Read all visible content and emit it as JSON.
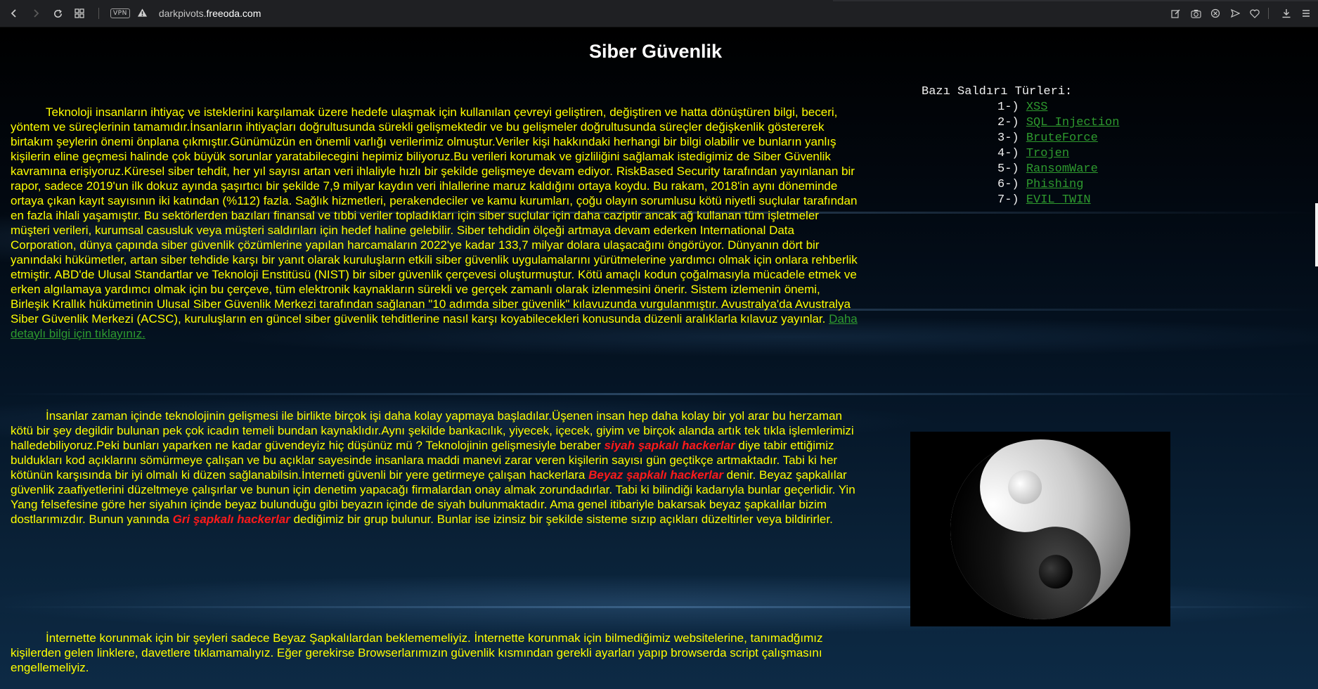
{
  "browser": {
    "url_prefix": "darkpivots.",
    "url_domain": "freeoda.com",
    "vpn_label": "VPN",
    "icons": {
      "back": "back-icon",
      "forward": "forward-icon",
      "reload": "reload-icon",
      "tabs": "tabs-grid-icon",
      "warning": "warning-icon",
      "edit": "edit-icon",
      "camera": "camera-icon",
      "block": "block-icon",
      "send": "send-icon",
      "heart": "heart-icon",
      "download": "download-icon",
      "menu": "menu-icon"
    }
  },
  "page": {
    "title": "Siber Güvenlik",
    "paragraph1": {
      "text": "Teknoloji insanların ihtiyaç ve isteklerini karşılamak üzere hedefe ulaşmak için kullanılan çevreyi geliştiren, değiştiren ve hatta dönüştüren bilgi, beceri, yöntem ve süreçlerinin tamamıdır.İnsanların ihtiyaçları doğrultusunda sürekli gelişmektedir ve bu gelişmeler doğrultusunda süreçler değişkenlik göstererek birtakım şeylerin önemi önplana çıkmıştır.Günümüzün en önemli varlığı verilerimiz olmuştur.Veriler kişi hakkındaki herhangi bir bilgi olabilir ve bunların yanlış kişilerin eline geçmesi halinde çok büyük sorunlar yaratabilecegini hepimiz biliyoruz.Bu verileri korumak ve gizliliğini sağlamak istedigimiz de Siber Güvenlik kavramına erişiyoruz.Küresel siber tehdit, her yıl sayısı artan veri ihlaliyle hızlı bir şekilde gelişmeye devam ediyor. RiskBased Security tarafından yayınlanan bir rapor, sadece 2019'un ilk dokuz ayında şaşırtıcı bir şekilde 7,9 milyar kaydın veri ihlallerine maruz kaldığını ortaya koydu. Bu rakam, 2018'in aynı döneminde ortaya çıkan kayıt sayısının iki katından (%112) fazla. Sağlık hizmetleri, perakendeciler ve kamu kurumları, çoğu olayın sorumlusu kötü niyetli suçlular tarafından en fazla ihlali yaşamıştır. Bu sektörlerden bazıları finansal ve tıbbi veriler topladıkları için siber suçlular için daha caziptir ancak ağ kullanan tüm işletmeler müşteri verileri, kurumsal casusluk veya müşteri saldırıları için hedef haline gelebilir. Siber tehdidin ölçeği artmaya devam ederken International Data Corporation, dünya çapında siber güvenlik çözümlerine yapılan harcamaların 2022'ye kadar 133,7 milyar dolara ulaşacağını öngörüyor. Dünyanın dört bir yanındaki hükümetler, artan siber tehdide karşı bir yanıt olarak kuruluşların etkili siber güvenlik uygulamalarını yürütmelerine yardımcı olmak için onlara rehberlik etmiştir. ABD'de Ulusal Standartlar ve Teknoloji Enstitüsü (NIST) bir siber güvenlik çerçevesi oluşturmuştur. Kötü amaçlı kodun çoğalmasıyla mücadele etmek ve erken algılamaya yardımcı olmak için bu çerçeve, tüm elektronik kaynakların sürekli ve gerçek zamanlı olarak izlenmesini önerir. Sistem izlemenin önemi, Birleşik Krallık hükümetinin Ulusal Siber Güvenlik Merkezi tarafından sağlanan \"10 adımda siber güvenlik\" kılavuzunda vurgulanmıştır. Avustralya'da Avustralya Siber Güvenlik Merkezi (ACSC), kuruluşların en güncel siber güvenlik tehditlerine nasıl karşı koyabilecekleri konusunda düzenli aralıklarla kılavuz yayınlar.",
      "link": "Daha detaylı bilgi için tıklayınız."
    },
    "paragraph2": {
      "part1": "İnsanlar zaman içinde teknolojinin gelişmesi ile birlikte birçok işi daha kolay yapmaya başladılar.Üşenen insan hep daha kolay bir yol arar bu herzaman kötü bir şey degildir bulunan pek çok icadın temeli bundan kaynaklıdır.Aynı şekilde bankacılık, yiyecek, içecek, giyim ve birçok alanda artık tek tıkla işlemlerimizi halledebiliyoruz.Peki bunları yaparken ne kadar güvendeyiz hiç düşünüz mü ? Teknolojinin gelişmesiyle beraber ",
      "highlight1": "siyah şapkalı hackerlar",
      "part2": " diye tabir ettiğimiz buldukları kod açıklarını sömürmeye çalışan ve bu açıklar sayesinde insanlara maddi manevi zarar veren kişilerin sayısı gün geçtikçe artmaktadır. Tabi ki her kötünün karşısında bir iyi olmalı ki düzen sağlanabilsin.İnterneti güvenli bir yere getirmeye çalışan hackerlara ",
      "highlight2": "Beyaz şapkalı hackerlar",
      "part3": " denir. Beyaz şapkalılar güvenlik zaafiyetlerini düzeltmeye çalışırlar ve bunun için denetim yapacağı firmalardan onay almak zorundadırlar. Tabi ki bilindiği kadarıyla bunlar geçerlidir. Yin Yang felsefesine göre her siyahın içinde beyaz bulunduğu gibi beyazın içinde de siyah bulunmaktadır. Ama genel itibariyle bakarsak beyaz şapkalılar bizim dostlarımızdır. Bunun yanında ",
      "highlight3": "Gri şapkalı hackerlar",
      "part4": " dediğimiz bir grup bulunur. Bunlar ise izinsiz bir şekilde sisteme sızıp açıkları düzeltirler veya bildirirler."
    },
    "paragraph3": {
      "text": "İnternette korunmak için bir şeyleri sadece Beyaz Şapkalılardan beklememeliyiz. İnternette korunmak için bilmediğimiz websitelerine, tanımadğımız kişilerden gelen linklere, davetlere tıklamamalıyız. Eğer gerekirse Browserlarımızın güvenlik kısmından gerekli ayarları yapıp browserda script çalışmasını engellemeliyiz."
    },
    "attacks": {
      "heading": "Bazı Saldırı Türleri:",
      "items": [
        {
          "num": "1-)",
          "label": "XSS"
        },
        {
          "num": "2-)",
          "label": "SQL Injection"
        },
        {
          "num": "3-)",
          "label": "BruteForce"
        },
        {
          "num": "4-)",
          "label": "Trojen"
        },
        {
          "num": "5-)",
          "label": "RansomWare"
        },
        {
          "num": "6-)",
          "label": "Phishing"
        },
        {
          "num": "7-)",
          "label": "EVIL TWIN"
        }
      ]
    },
    "image": {
      "icon": "yin-yang-icon"
    },
    "colors": {
      "text": "#ffff00",
      "link": "#2e9a2e",
      "highlight": "#ff1a1a",
      "title": "#ffffff"
    }
  }
}
